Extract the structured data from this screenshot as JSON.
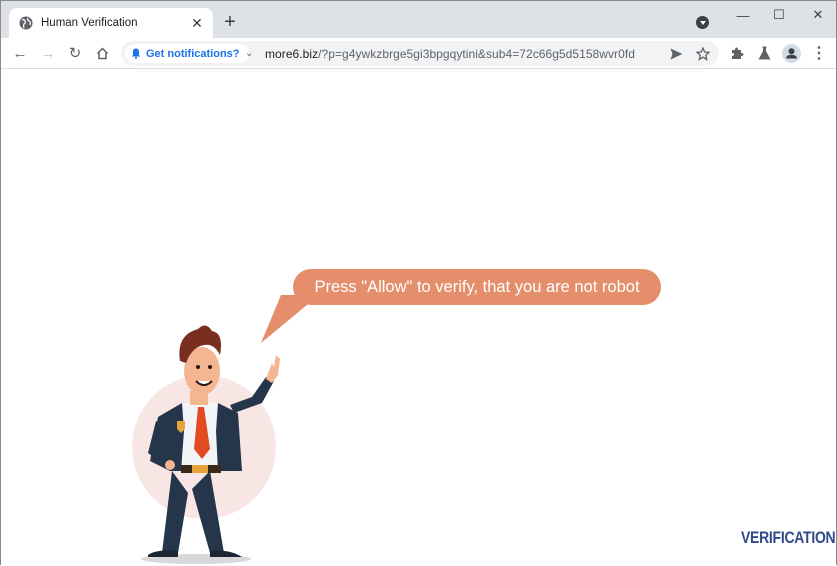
{
  "browser": {
    "tab": {
      "title": "Human Verification",
      "favicon": "globe-icon",
      "close_icon": "close-icon"
    },
    "new_tab_icon": "plus-icon",
    "tab_search_icon": "tab-search-icon",
    "window_controls": {
      "minimize": "—",
      "maximize": "☐",
      "close": "✕"
    },
    "toolbar": {
      "back_icon": "←",
      "forward_icon": "→",
      "reload_icon": "↻",
      "home_icon": "home-icon"
    },
    "omnibox": {
      "notification_chip": "Get notifications?",
      "url_host": "more6.biz",
      "url_path": "/?p=g4ywkzbrge5gi3bpgqytini&sub4=72c66g5d5158wvr0fd"
    }
  },
  "page": {
    "bubble_text": "Press \"Allow\" to verify, that you are not robot",
    "brand_text": "VERIFICATION",
    "colors": {
      "bubble": "#e58e6c",
      "brand": "#2e4a8a",
      "suit": "#25364a",
      "tie": "#e24a22",
      "halo": "#f7e6e4"
    }
  }
}
